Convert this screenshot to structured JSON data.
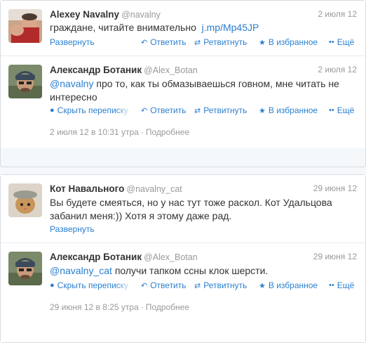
{
  "conversation1": {
    "tweet1": {
      "name": "Alexey Navalny",
      "handle": "@navalny",
      "date": "2 июля 12",
      "text_before": "граждане, читайте внимательно ",
      "link": "j.mp/Mp45JP",
      "expand": "Развернуть",
      "reply": "Ответить",
      "retweet": "Ретвитнуть",
      "favorite": "В избранное",
      "more": "Ещё"
    },
    "tweet2": {
      "name": "Александр Ботаник",
      "handle": "@Alex_Botan",
      "date": "2 июля 12",
      "mention": "@navalny",
      "text_after": " про то, как ты обмазываешься говном, мне читать не интересно",
      "conversation": "Скрыть переписку",
      "reply": "Ответить",
      "retweet": "Ретвитнуть",
      "favorite": "В избранное",
      "more": "Ещё",
      "timestamp": "2 июля 12 в 10:31 утра",
      "sep": "·",
      "details": "Подробнее"
    }
  },
  "conversation2": {
    "tweet1": {
      "name": "Кот Навального",
      "handle": "@navalny_cat",
      "date": "29 июня 12",
      "text": "Вы будете смеяться, но у нас тут тоже раскол. Кот Удальцова забанил меня:)) Хотя я этому даже рад.",
      "expand": "Развернуть"
    },
    "tweet2": {
      "name": "Александр Ботаник",
      "handle": "@Alex_Botan",
      "date": "29 июня 12",
      "mention": "@navalny_cat",
      "text_after": " получи тапком ссны клок шерсти.",
      "conversation": "Скрыть переписку",
      "reply": "Ответить",
      "retweet": "Ретвитнуть",
      "favorite": "В избранное",
      "more": "Ещё",
      "timestamp": "29 июня 12 в 8:25 утра",
      "sep": "·",
      "details": "Подробнее"
    }
  },
  "icons": {
    "reply": "reply-icon",
    "retweet": "retweet-icon",
    "favorite": "star-icon",
    "more": "more-icon",
    "conversation": "conversation-icon"
  },
  "colors": {
    "link": "#2a7fcf",
    "muted": "#999999",
    "text": "#333333",
    "border": "#d7dde2"
  }
}
